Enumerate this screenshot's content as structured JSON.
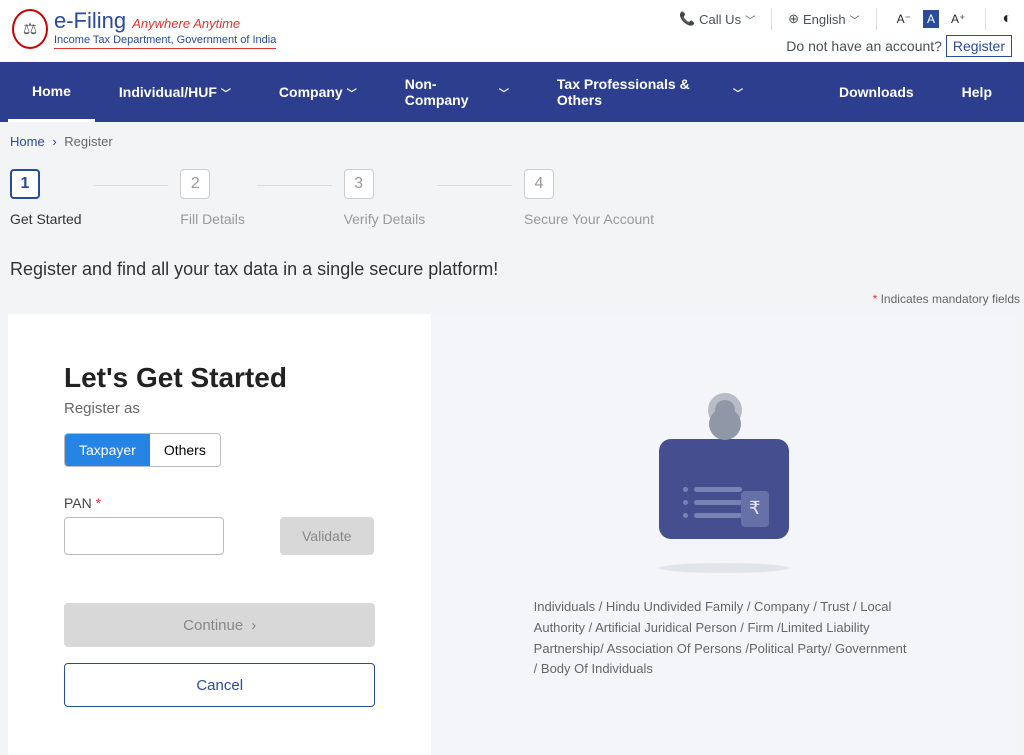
{
  "header": {
    "logo_title": "e-Filing",
    "logo_tagline": "Anywhere Anytime",
    "logo_dept": "Income Tax Department, Government of India",
    "call_us": "Call Us",
    "language": "English",
    "font_minus": "A⁻",
    "font_normal": "A",
    "font_plus": "A⁺",
    "no_account": "Do not have an account?",
    "register_link": "Register"
  },
  "nav": {
    "items": [
      "Home",
      "Individual/HUF",
      "Company",
      "Non-Company",
      "Tax Professionals & Others",
      "Downloads",
      "Help"
    ]
  },
  "breadcrumb": {
    "home": "Home",
    "current": "Register"
  },
  "stepper": {
    "steps": [
      {
        "num": "1",
        "label": "Get Started"
      },
      {
        "num": "2",
        "label": "Fill Details"
      },
      {
        "num": "3",
        "label": "Verify Details"
      },
      {
        "num": "4",
        "label": "Secure Your Account"
      }
    ]
  },
  "page": {
    "title": "Register and find all your tax data in a single secure platform!",
    "mandatory": "Indicates mandatory fields"
  },
  "form": {
    "title": "Let's Get Started",
    "subtitle": "Register as",
    "tab_taxpayer": "Taxpayer",
    "tab_others": "Others",
    "pan_label": "PAN",
    "validate": "Validate",
    "continue": "Continue",
    "cancel": "Cancel"
  },
  "illustration": {
    "rupee": "₹",
    "caption": "Individuals / Hindu Undivided Family / Company / Trust / Local Authority / Artificial Juridical Person / Firm /Limited Liability Partnership/ Association Of Persons /Political Party/ Government / Body Of Individuals"
  }
}
